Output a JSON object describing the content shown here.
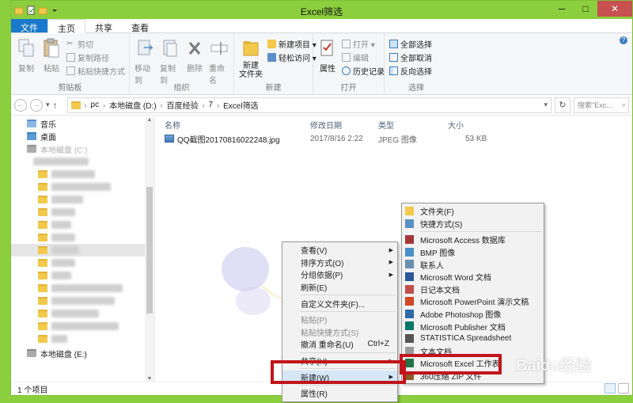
{
  "window": {
    "title": "Excel筛选"
  },
  "tabs": [
    "文件",
    "主页",
    "共享",
    "查看"
  ],
  "ribbon": {
    "clipboard": {
      "label": "剪贴板",
      "copy": "复制",
      "paste": "粘贴",
      "cut": "剪切",
      "copy_path": "复制路径",
      "paste_shortcut": "粘贴快捷方式"
    },
    "organize": {
      "label": "组织",
      "move_to": "移动到",
      "copy_to": "复制到",
      "delete": "删除",
      "rename": "重命名"
    },
    "new": {
      "label": "新建",
      "new_folder": "新建\n文件夹",
      "new_item": "新建项目 ▾",
      "easy_access": "轻松访问 ▾"
    },
    "open": {
      "label": "打开",
      "properties": "属性",
      "open": "打开 ▾",
      "edit": "编辑",
      "history": "历史记录"
    },
    "select": {
      "label": "选择",
      "select_all": "全部选择",
      "select_none": "全部取消",
      "invert": "反向选择"
    }
  },
  "address": {
    "path": [
      "pc",
      "本地磁盘 (D:)",
      "百度经验",
      "7",
      "Excel筛选"
    ],
    "search_placeholder": "搜索\"Exc...",
    "nav_up": "↑"
  },
  "sidebar": {
    "items": [
      {
        "label": "音乐"
      },
      {
        "label": "桌面"
      },
      {
        "label": "本地磁盘 (C:)"
      },
      {
        "label": "本地磁盘 (E:)"
      }
    ]
  },
  "columns": {
    "name": "名称",
    "date": "修改日期",
    "type": "类型",
    "size": "大小"
  },
  "files": [
    {
      "name": "QQ截图20170816022248.jpg",
      "date": "2017/8/16 2:22",
      "type": "JPEG 图像",
      "size": "53 KB"
    }
  ],
  "status": {
    "count": "1 个项目"
  },
  "context_menu": {
    "items": [
      {
        "label": "查看(V)",
        "arrow": true
      },
      {
        "label": "排序方式(O)",
        "arrow": true
      },
      {
        "label": "分组依据(P)",
        "arrow": true
      },
      {
        "label": "刷新(E)"
      },
      {
        "label": "自定义文件夹(F)..."
      },
      {
        "label": "粘贴(P)",
        "disabled": true
      },
      {
        "label": "粘贴快捷方式(S)",
        "disabled": true
      },
      {
        "label": "撤消 重命名(U)",
        "shortcut": "Ctrl+Z"
      },
      {
        "label": "共享(H)",
        "arrow": true
      },
      {
        "label": "新建(W)",
        "arrow": true,
        "highlight": true
      },
      {
        "label": "属性(R)"
      }
    ]
  },
  "new_submenu": {
    "items": [
      {
        "label": "文件夹(F)",
        "icon": "folder-icon",
        "color": "#f2c94c"
      },
      {
        "label": "快捷方式(S)",
        "icon": "shortcut-icon",
        "color": "#5b8fc7"
      },
      {
        "label": "Microsoft Access 数据库",
        "icon": "access-icon",
        "color": "#a4373a"
      },
      {
        "label": "BMP 图像",
        "icon": "bmp-icon",
        "color": "#4a90c9"
      },
      {
        "label": "联系人",
        "icon": "contact-icon",
        "color": "#6a8fb0"
      },
      {
        "label": "Microsoft Word 文档",
        "icon": "word-icon",
        "color": "#2b579a"
      },
      {
        "label": "日记本文档",
        "icon": "journal-icon",
        "color": "#c0504d"
      },
      {
        "label": "Microsoft PowerPoint 演示文稿",
        "icon": "powerpoint-icon",
        "color": "#d24726"
      },
      {
        "label": "Adobe Photoshop 图像",
        "icon": "photoshop-icon",
        "color": "#2d6aa8"
      },
      {
        "label": "Microsoft Publisher 文档",
        "icon": "publisher-icon",
        "color": "#077568"
      },
      {
        "label": "STATISTICA Spreadsheet",
        "icon": "statistica-icon",
        "color": "#555555"
      },
      {
        "label": "文本文档",
        "icon": "text-icon",
        "color": "#9a9a9a"
      },
      {
        "label": "Microsoft Excel 工作表",
        "icon": "excel-icon",
        "color": "#217346"
      },
      {
        "label": "360压缩 ZIP 文件",
        "icon": "zip-icon",
        "color": "#8a5a2b"
      }
    ]
  },
  "watermark": {
    "text": "Baidu经验"
  },
  "colors": {
    "accent": "#8ccf3e",
    "file_tab": "#1979ca",
    "highlight_box": "#c1141b"
  }
}
